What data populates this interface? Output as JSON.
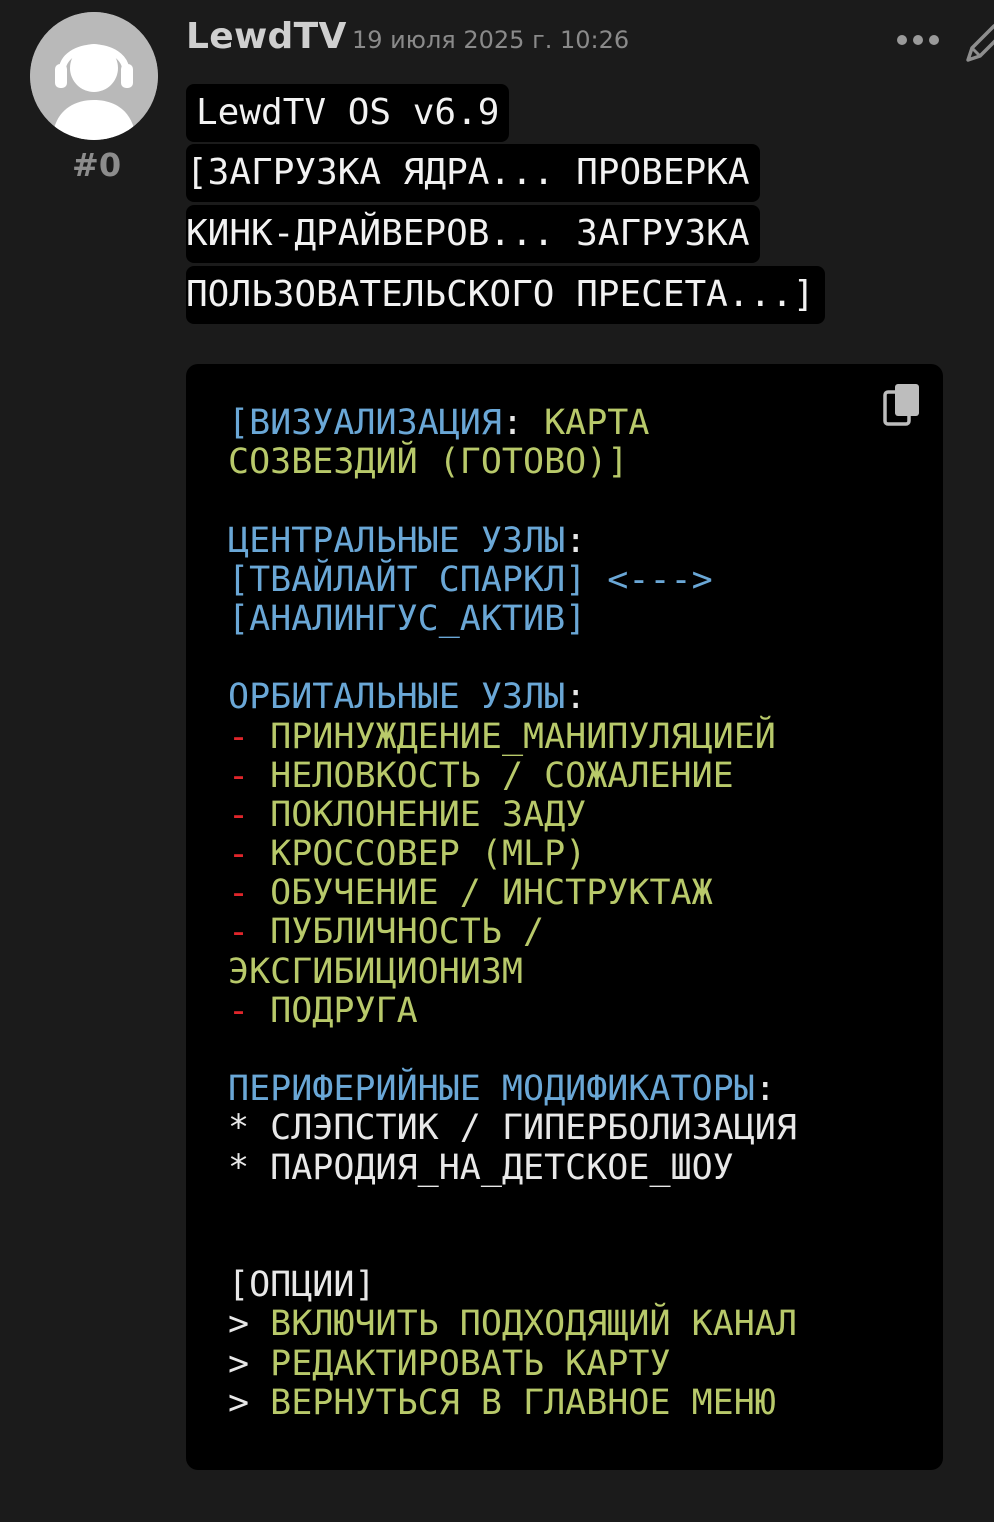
{
  "post": {
    "username": "LewdTV",
    "timestamp": "19 июля 2025 г. 10:26",
    "post_number": "#0",
    "icons": {
      "avatar": "headphones-user-avatar",
      "more": "more-dots-icon",
      "edit": "pencil-icon",
      "copy": "copy-icon"
    }
  },
  "intro": {
    "line1": "LewdTV OS v6.9",
    "line2": "[ЗАГРУЗКА ЯДРА... ПРОВЕРКА ",
    "line3": "КИНК-ДРАЙВЕРОВ... ЗАГРУЗКА ",
    "line4": "ПОЛЬЗОВАТЕЛЬСКОГО ПРЕСЕТА...]"
  },
  "code": {
    "viz_key": "[ВИЗУАЛИЗАЦИЯ",
    "colon": ":",
    "viz_val_1": " КАРТА",
    "viz_val_2": "СОЗВЕЗДИЙ (ГОТОВО)]",
    "central_header": "ЦЕНТРАЛЬНЫЕ УЗЛЫ",
    "central_node_1": "[ТВАЙЛАЙТ СПАРКЛ]",
    "central_arrow": " <--->",
    "central_node_2": "[АНАЛИНГУС_АКТИВ]",
    "orbital_header": "ОРБИТАЛЬНЫЕ УЗЛЫ",
    "dash": "- ",
    "orbital_1": "ПРИНУЖДЕНИЕ_МАНИПУЛЯЦИЕЙ",
    "orbital_2": "НЕЛОВКОСТЬ / СОЖАЛЕНИЕ",
    "orbital_3": "ПОКЛОНЕНИЕ ЗАДУ",
    "orbital_4": "КРОССОВЕР (MLP)",
    "orbital_5": "ОБУЧЕНИЕ / ИНСТРУКТАЖ",
    "orbital_6a": "ПУБЛИЧНОСТЬ /",
    "orbital_6b": "ЭКСГИБИЦИОНИЗМ",
    "orbital_7": "ПОДРУГА",
    "peripheral_header": "ПЕРИФЕРИЙНЫЕ МОДИФИКАТОРЫ",
    "star": "* ",
    "peripheral_1": "СЛЭПСТИК / ГИПЕРБОЛИЗАЦИЯ",
    "peripheral_2": "ПАРОДИЯ_НА_ДЕТСКОЕ_ШОУ",
    "options_header": "[ОПЦИИ]",
    "prompt": "> ",
    "option_1": "ВКЛЮЧИТЬ ПОДХОДЯЩИЙ КАНАЛ",
    "option_2": "РЕДАКТИРОВАТЬ КАРТУ",
    "option_3": "ВЕРНУТЬСЯ В ГЛАВНОЕ МЕНЮ"
  },
  "colors": {
    "background": "#1b1b1b",
    "code_background": "#000000",
    "blue": "#6aa7d6",
    "green": "#b8c96a",
    "red": "#e0262b",
    "white": "#e8e8e8"
  }
}
